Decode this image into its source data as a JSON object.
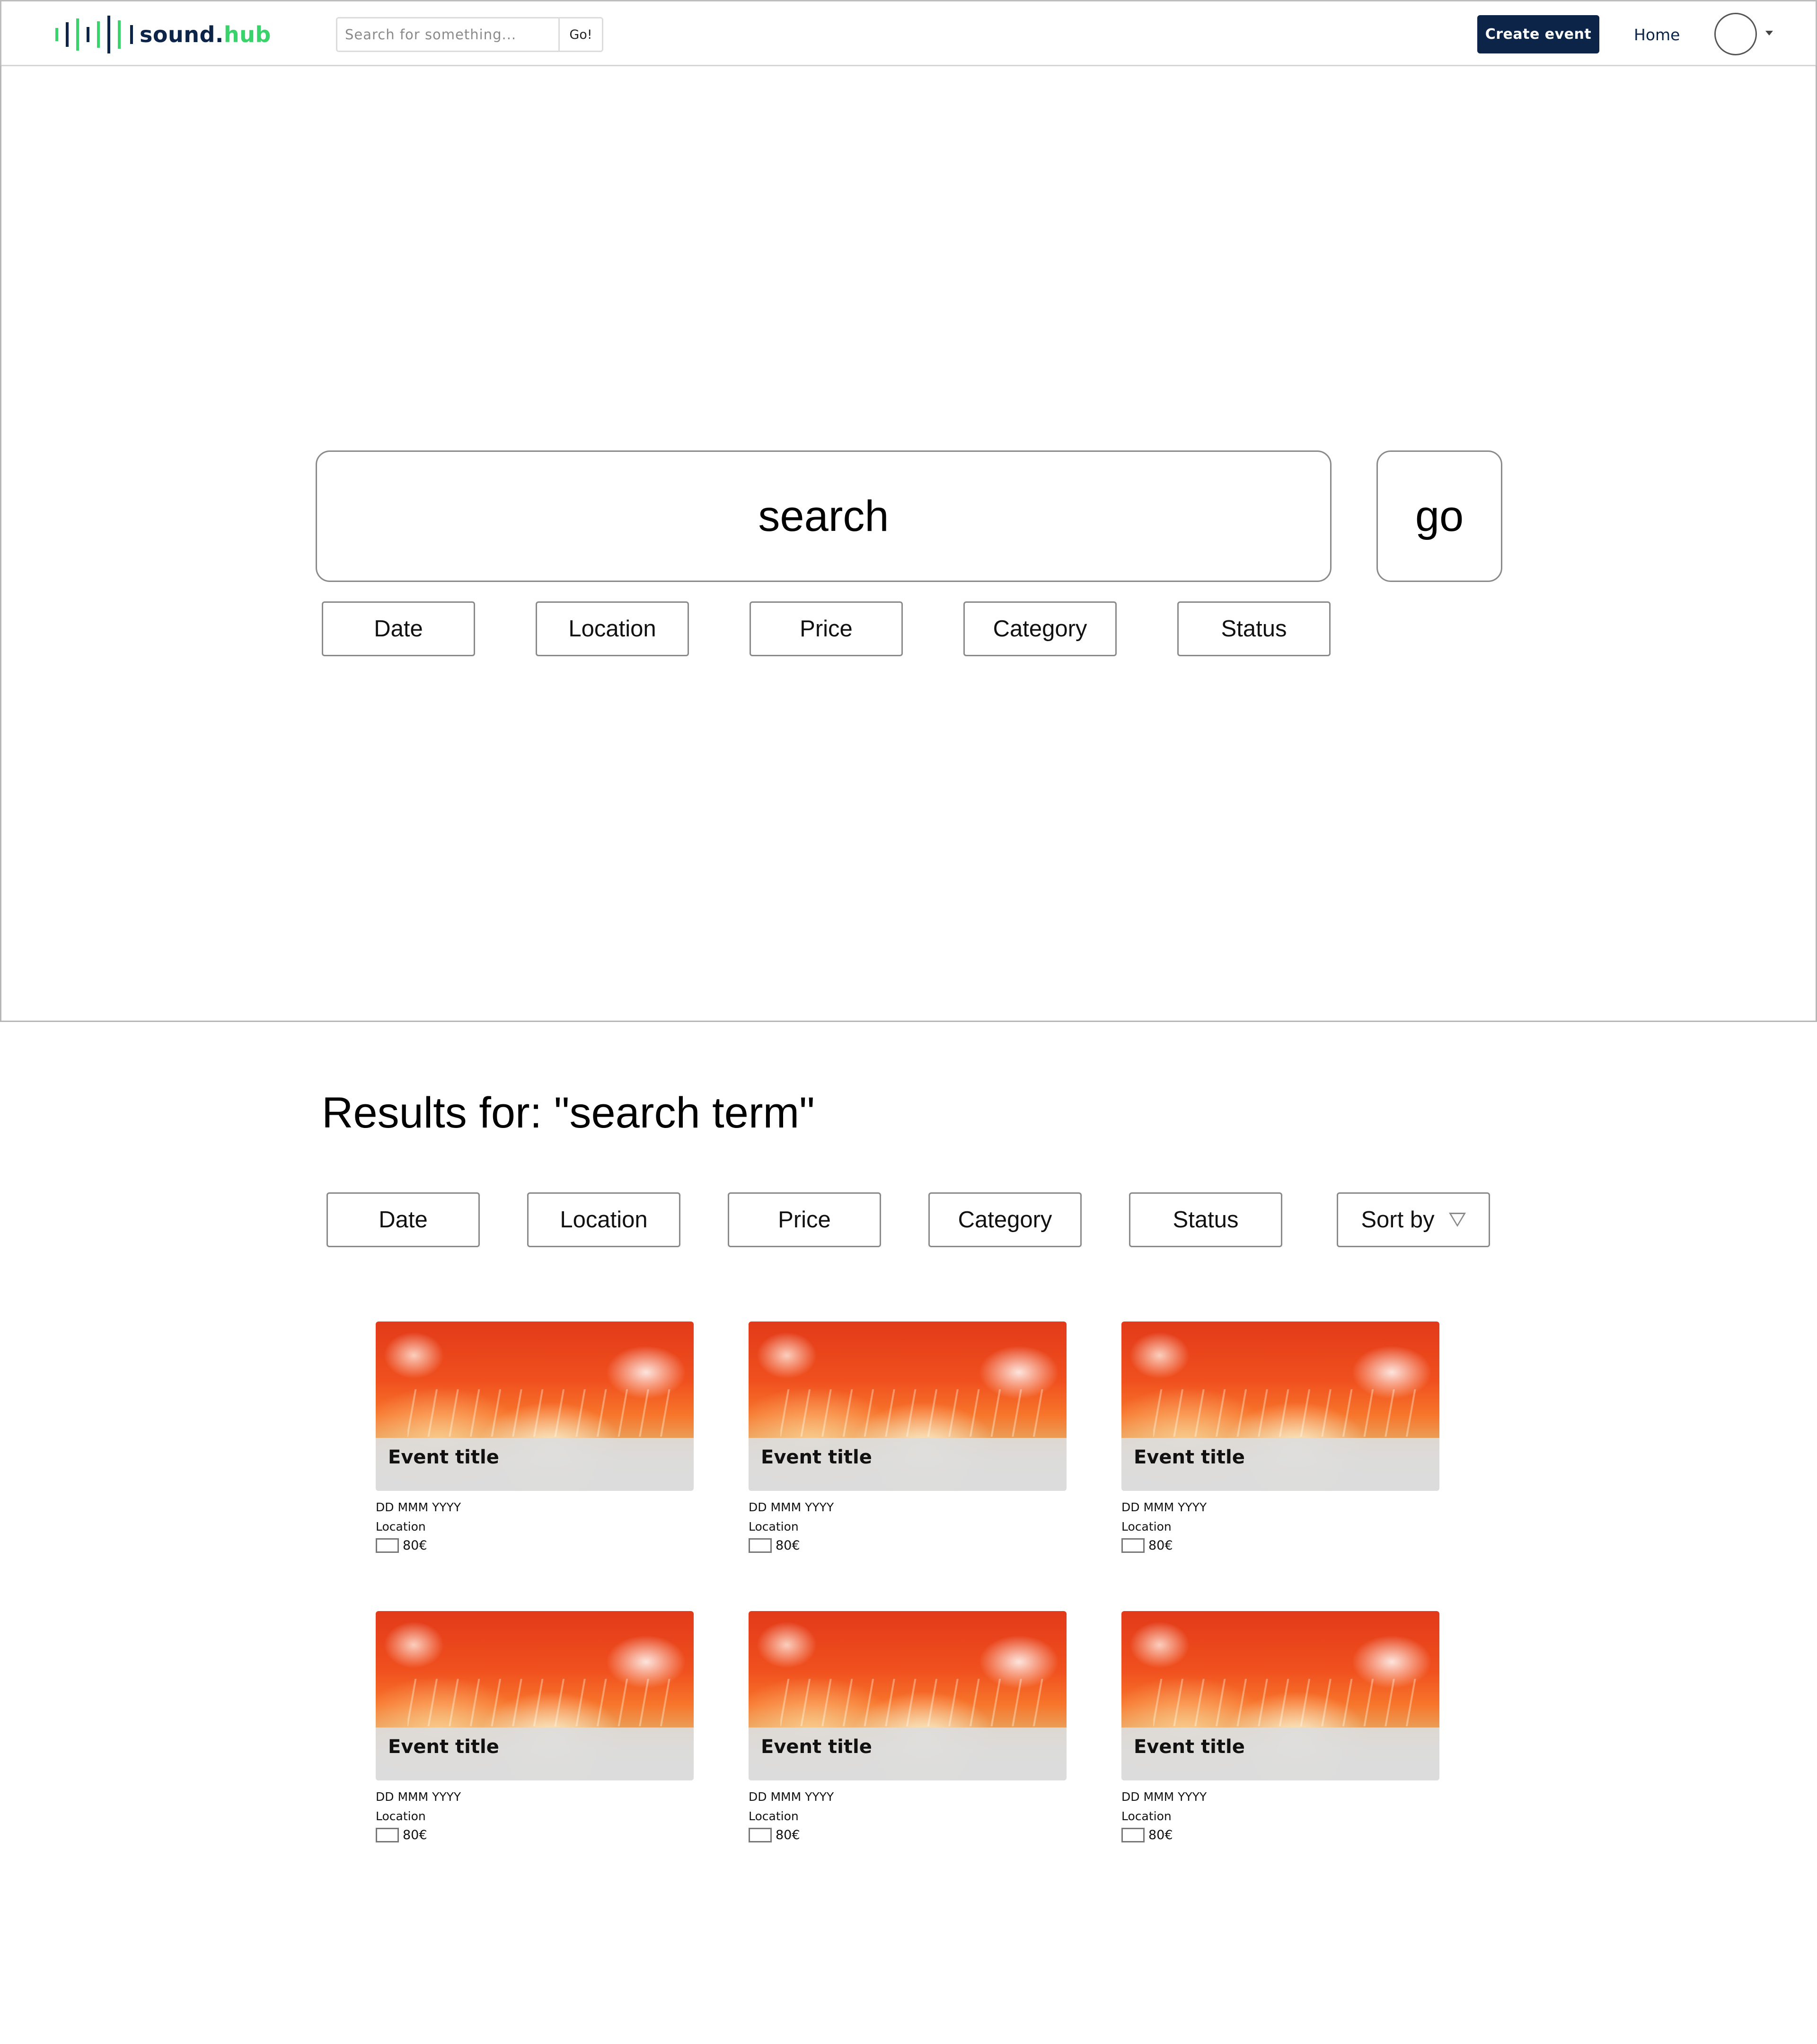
{
  "nav": {
    "logo_text_main": "sound.",
    "logo_text_accent": "hub",
    "search_placeholder": "Search for something...",
    "search_go": "Go!",
    "create_event": "Create event",
    "home": "Home"
  },
  "hero": {
    "search_label": "search",
    "go_label": "go",
    "filters": [
      "Date",
      "Location",
      "Price",
      "Category",
      "Status"
    ]
  },
  "results": {
    "title": "Results for: \"search term\"",
    "filters": [
      "Date",
      "Location",
      "Price",
      "Category",
      "Status"
    ],
    "sort_label": "Sort by"
  },
  "events": [
    {
      "title": "Event title",
      "date": "DD MMM YYYY",
      "location": "Location",
      "price": "80€"
    },
    {
      "title": "Event title",
      "date": "DD MMM YYYY",
      "location": "Location",
      "price": "80€"
    },
    {
      "title": "Event title",
      "date": "DD MMM YYYY",
      "location": "Location",
      "price": "80€"
    },
    {
      "title": "Event title",
      "date": "DD MMM YYYY",
      "location": "Location",
      "price": "80€"
    },
    {
      "title": "Event title",
      "date": "DD MMM YYYY",
      "location": "Location",
      "price": "80€"
    },
    {
      "title": "Event title",
      "date": "DD MMM YYYY",
      "location": "Location",
      "price": "80€"
    }
  ],
  "colors": {
    "brand_navy": "#0b2447",
    "brand_green": "#3ad36b"
  },
  "icons": [
    "soundwave-logo-icon",
    "avatar-icon",
    "dropdown-caret-icon",
    "sort-caret-icon"
  ]
}
